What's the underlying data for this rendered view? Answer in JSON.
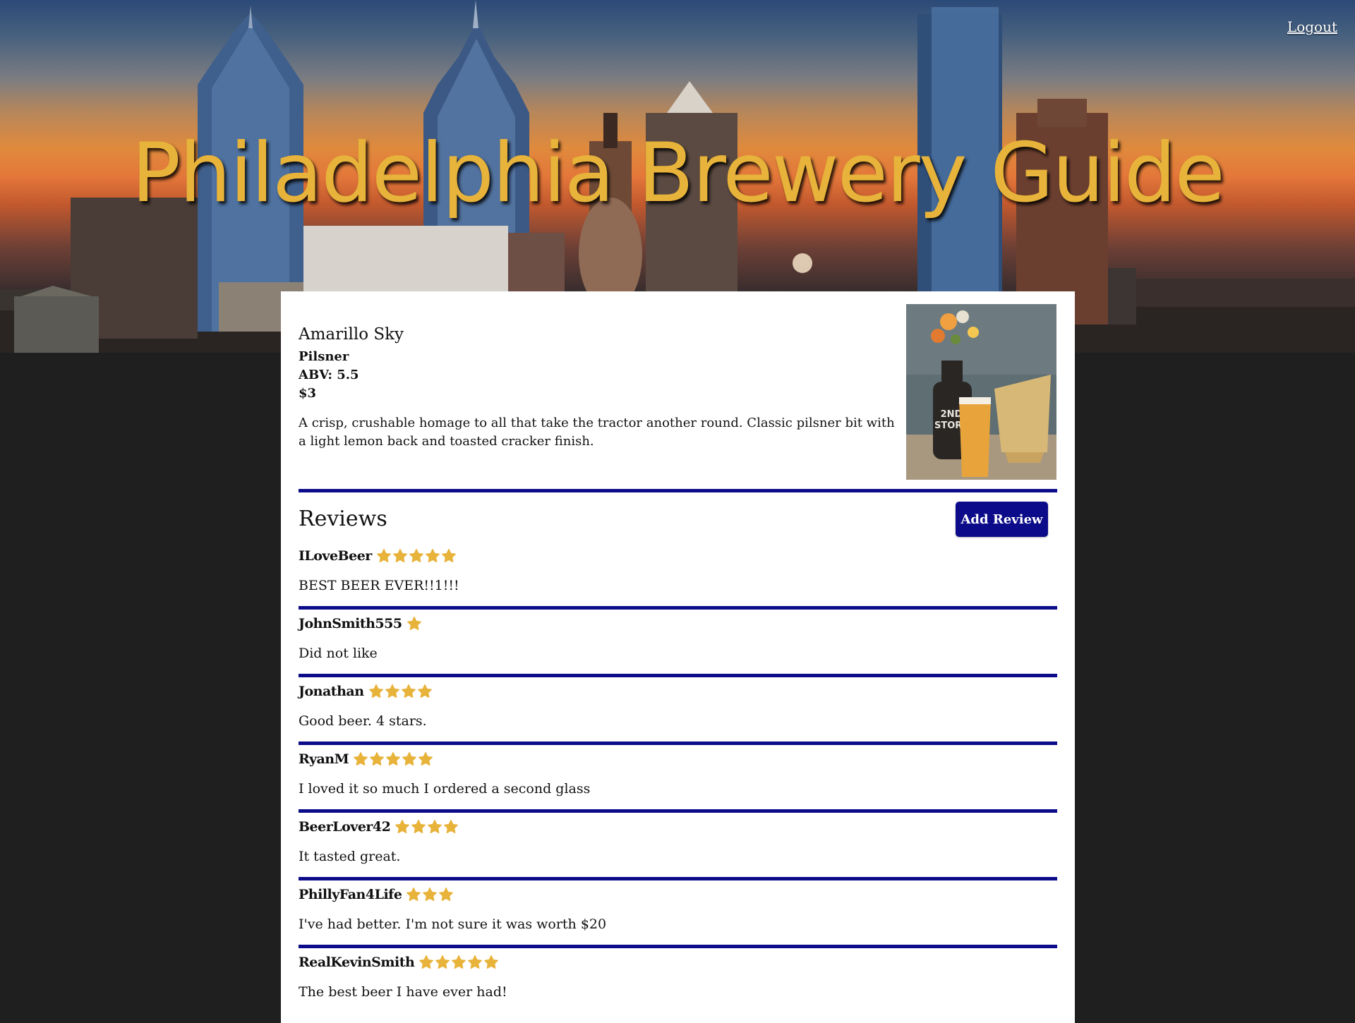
{
  "header": {
    "title": "Philadelphia Brewery Guide",
    "logout_label": "Logout"
  },
  "beer": {
    "name": "Amarillo Sky",
    "style": "Pilsner",
    "abv": "ABV: 5.5",
    "price": "$3",
    "description": "A crisp, crushable homage to all that take the tractor another round. Classic pilsner bit with a light lemon back and toasted cracker finish."
  },
  "reviews_section": {
    "heading": "Reviews",
    "add_review_label": "Add Review"
  },
  "reviews": [
    {
      "user": "ILoveBeer",
      "rating": 5,
      "text": "BEST BEER EVER!!1!!!"
    },
    {
      "user": "JohnSmith555",
      "rating": 1,
      "text": "Did not like"
    },
    {
      "user": "Jonathan",
      "rating": 4,
      "text": "Good beer. 4 stars."
    },
    {
      "user": "RyanM",
      "rating": 5,
      "text": "I loved it so much I ordered a second glass"
    },
    {
      "user": "BeerLover42",
      "rating": 4,
      "text": "It tasted great."
    },
    {
      "user": "PhillyFan4Life",
      "rating": 3,
      "text": "I've had better. I'm not sure it was worth $20"
    },
    {
      "user": "RealKevinSmith",
      "rating": 5,
      "text": "The best beer I have ever had!"
    }
  ],
  "colors": {
    "accent": "#0c0c8a",
    "star": "#e8b33a",
    "title": "#e8b33a",
    "page_background": "#1f1f1f"
  },
  "icons": {
    "star": "star-icon"
  }
}
